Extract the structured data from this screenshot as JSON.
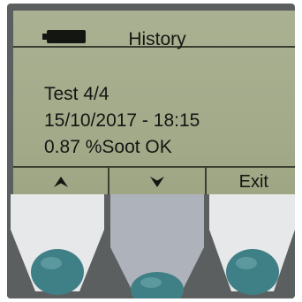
{
  "screen": {
    "title": "History",
    "battery_icon": "battery-full-icon",
    "lines": [
      "Test 4/4",
      "15/10/2017 - 18:15",
      "0.87 %Soot OK"
    ]
  },
  "softkeys": {
    "up_icon": "arrow-up-icon",
    "down_icon": "arrow-down-icon",
    "exit_label": "Exit"
  },
  "colors": {
    "lcd_background": "#a6ae8f",
    "lcd_text": "#141612",
    "bezel": "#5c5f5f",
    "key_face": "#e7e8ea",
    "key_face_pressed": "#aeb3bb",
    "key_dome": "#3f7f86"
  }
}
